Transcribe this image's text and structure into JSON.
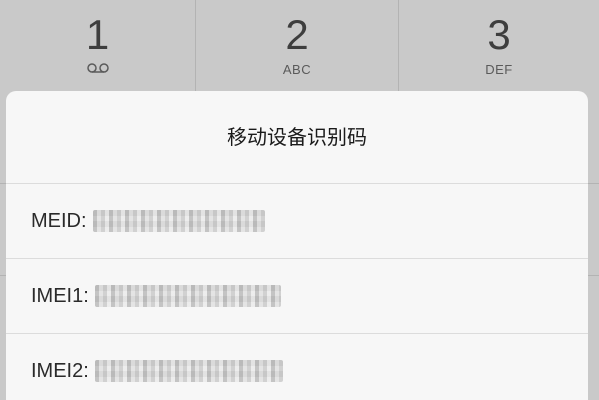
{
  "dialpad": {
    "keys": [
      {
        "digit": "1",
        "letters": "",
        "icon": "voicemail-icon"
      },
      {
        "digit": "2",
        "letters": "ABC"
      },
      {
        "digit": "3",
        "letters": "DEF"
      }
    ]
  },
  "dialog": {
    "title": "移动设备识别码",
    "rows": [
      {
        "label": "MEID:",
        "value_redacted": true
      },
      {
        "label": "IMEI1:",
        "value_redacted": true
      },
      {
        "label": "IMEI2:",
        "value_redacted": true
      }
    ]
  },
  "colors": {
    "dialpad_background": "#c9c9c9",
    "dialog_background": "#f7f7f7",
    "divider": "#dcdcdc",
    "text": "#1a1a1a"
  }
}
